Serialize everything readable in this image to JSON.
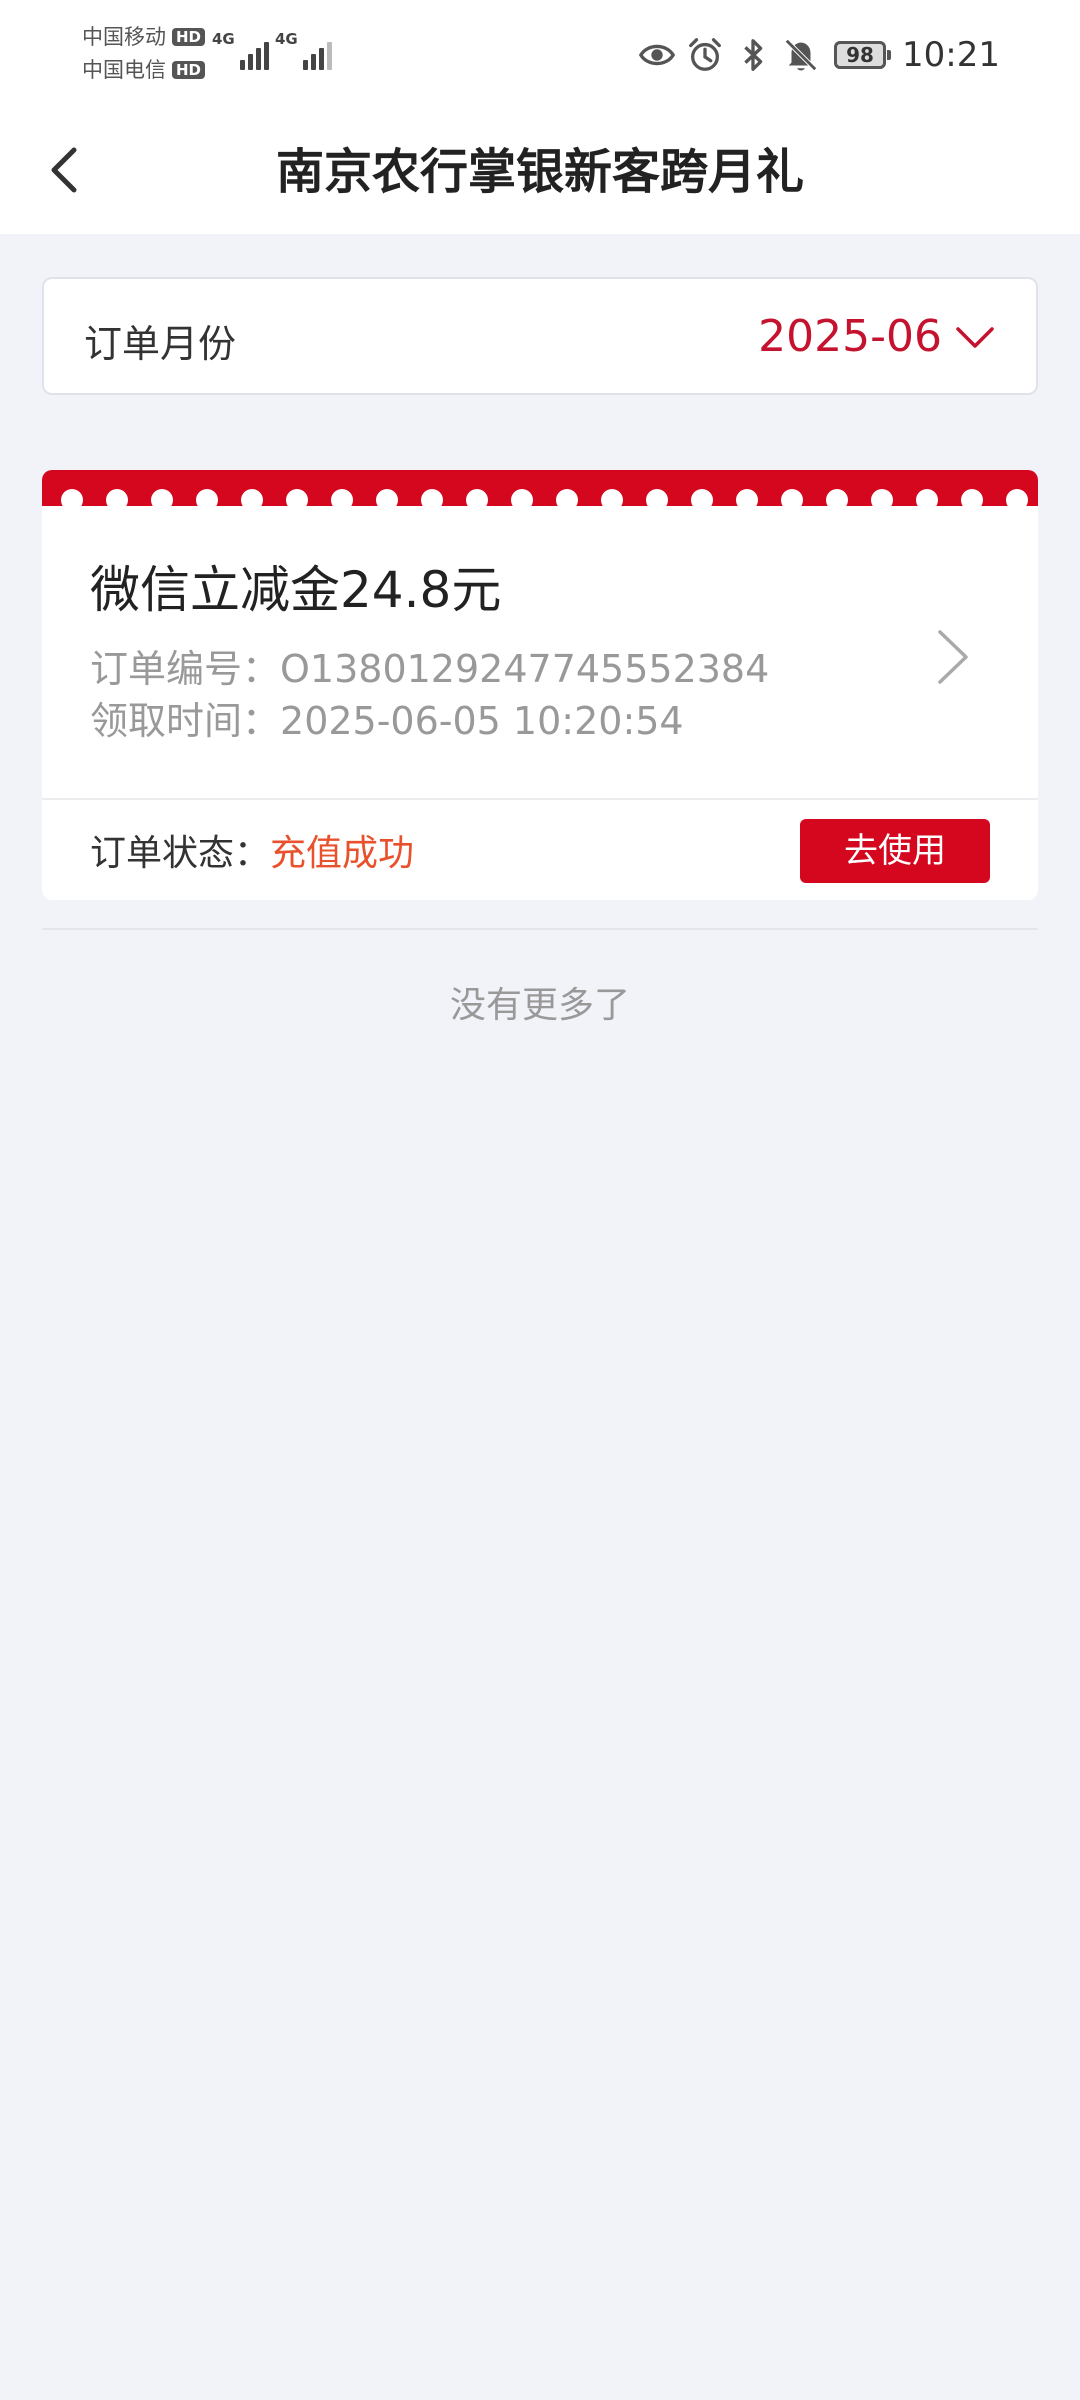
{
  "status_bar": {
    "carrier_1": "中国移动",
    "carrier_2": "中国电信",
    "hd_badge": "HD",
    "network_1": "4G",
    "network_2": "4G",
    "icons": [
      "eye-icon",
      "alarm-icon",
      "bluetooth-icon",
      "mute-bell-icon"
    ],
    "battery": "98",
    "time": "10:21"
  },
  "header": {
    "title": "南京农行掌银新客跨月礼",
    "back_icon": "chevron-left-icon"
  },
  "month_selector": {
    "label": "订单月份",
    "value": "2025-06",
    "accent_color": "#c4122f"
  },
  "orders": [
    {
      "title": "微信立减金24.8元",
      "order_no_label": "订单编号：",
      "order_no": "O1380129247745552384",
      "claim_time_label": "领取时间：",
      "claim_time": "2025-06-05 10:20:54",
      "status_label": "订单状态：",
      "status_value": "充值成功",
      "status_color": "#e8512b",
      "action_label": "去使用"
    }
  ],
  "list_end": "没有更多了",
  "colors": {
    "brand_red": "#d4071f",
    "background": "#f2f3f8"
  }
}
